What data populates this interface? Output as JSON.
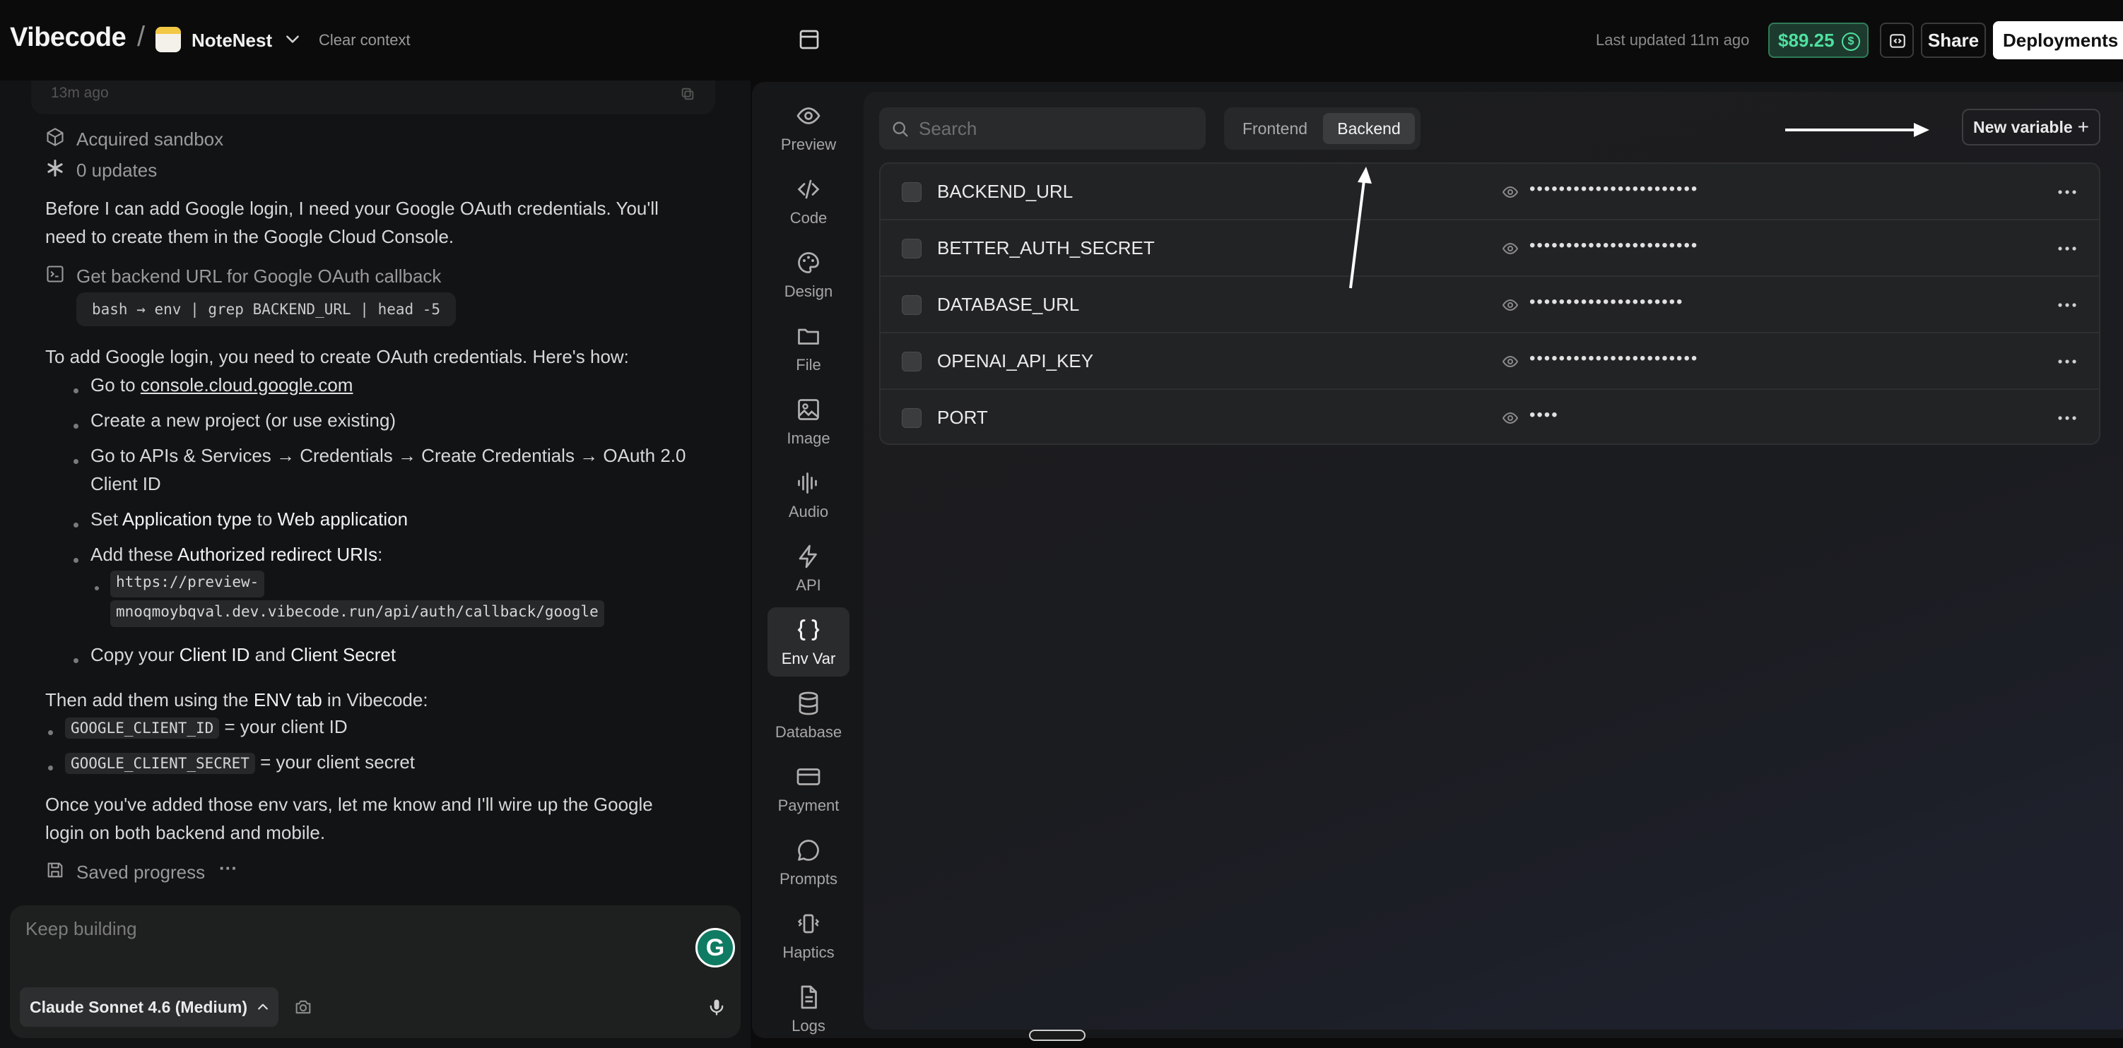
{
  "header": {
    "brand": "Vibecode",
    "separator": "/",
    "project_name": "NoteNest",
    "clear_context": "Clear context",
    "last_updated": "Last updated 11m ago",
    "credits": "$89.25",
    "credits_icon": "$",
    "share": "Share",
    "deployments": "Deployments"
  },
  "chat": {
    "timestamp": "13m ago",
    "acquired_sandbox": "Acquired sandbox",
    "updates": "0 updates",
    "intro_line1": "Before I can add Google login, I need your Google OAuth credentials. You'll",
    "intro_line2": "need to create them in the Google Cloud Console.",
    "tool_call": "Get backend URL for Google OAuth callback",
    "command": "bash → env | grep BACKEND_URL | head -5",
    "howto": "To add Google login, you need to create OAuth credentials. Here's how:",
    "step1_prefix": "Go to ",
    "step1_link": "console.cloud.google.com",
    "step2": "Create a new project (or use existing)",
    "step3_line1": "Go to APIs & Services → Credentials → Create Credentials → OAuth 2.0",
    "step3_line2": "Client ID",
    "step4_prefix": "Set ",
    "step4_b1": "Application type",
    "step4_mid": " to ",
    "step4_b2": "Web application",
    "step5_prefix": "Add these ",
    "step5_b": "Authorized redirect URIs",
    "step5_suffix": ":",
    "uri_line1": "https://preview-",
    "uri_line2": "mnoqmoybqval.dev.vibecode.run/api/auth/callback/google",
    "step6_prefix": "Copy your ",
    "step6_b1": "Client ID",
    "step6_mid": " and ",
    "step6_b2": "Client Secret",
    "then_prefix": "Then add them using the ",
    "then_b": "ENV tab",
    "then_suffix": " in Vibecode:",
    "env1_code": "GOOGLE_CLIENT_ID",
    "env1_desc": " = your client ID",
    "env2_code": "GOOGLE_CLIENT_SECRET",
    "env2_desc": " = your client secret",
    "outro_line1": "Once you've added those env vars, let me know and I'll wire up the Google",
    "outro_line2": "login on both backend and mobile.",
    "saved_progress": "Saved progress",
    "saved_more": "···"
  },
  "composer": {
    "placeholder": "Keep building",
    "grammarly": "G",
    "model": "Claude Sonnet 4.6 (Medium)"
  },
  "rail": {
    "items": [
      {
        "label": "Preview",
        "icon": "eye-icon"
      },
      {
        "label": "Code",
        "icon": "code-icon"
      },
      {
        "label": "Design",
        "icon": "palette-icon"
      },
      {
        "label": "File",
        "icon": "folder-icon"
      },
      {
        "label": "Image",
        "icon": "image-icon"
      },
      {
        "label": "Audio",
        "icon": "audio-wave-icon"
      },
      {
        "label": "API",
        "icon": "lightning-icon"
      },
      {
        "label": "Env Var",
        "icon": "braces-icon"
      },
      {
        "label": "Database",
        "icon": "database-icon"
      },
      {
        "label": "Payment",
        "icon": "credit-card-icon"
      },
      {
        "label": "Prompts",
        "icon": "chat-bubble-icon"
      },
      {
        "label": "Haptics",
        "icon": "vibrate-icon"
      },
      {
        "label": "Logs",
        "icon": "document-icon"
      }
    ],
    "active": "Env Var"
  },
  "env": {
    "search_placeholder": "Search",
    "tabs": [
      "Frontend",
      "Backend"
    ],
    "active_tab": "Backend",
    "new_variable": "New variable",
    "new_variable_icon": "+",
    "rows": [
      {
        "key": "BACKEND_URL",
        "value": "•••••••••••••••••••••••"
      },
      {
        "key": "BETTER_AUTH_SECRET",
        "value": "•••••••••••••••••••••••"
      },
      {
        "key": "DATABASE_URL",
        "value": "•••••••••••••••••••••"
      },
      {
        "key": "OPENAI_API_KEY",
        "value": "•••••••••••••••••••••••"
      },
      {
        "key": "PORT",
        "value": "••••"
      }
    ]
  },
  "colors": {
    "accent_green": "#4fe0a0",
    "background": "#0b0b0c",
    "panel": "#161718"
  }
}
